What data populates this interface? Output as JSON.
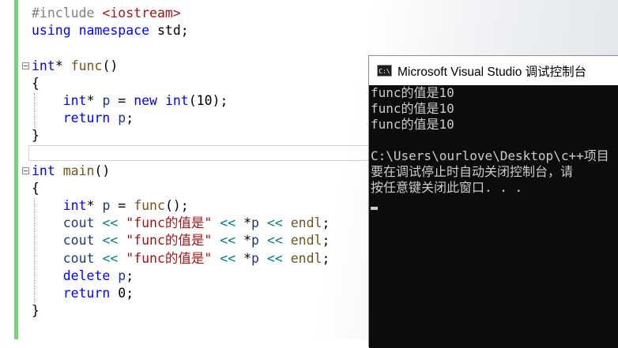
{
  "editor": {
    "lines": [
      {
        "tokens": [
          {
            "c": "pp",
            "t": "#include "
          },
          {
            "c": "inc",
            "t": "<iostream>"
          }
        ]
      },
      {
        "tokens": [
          {
            "c": "kw",
            "t": "using"
          },
          {
            "c": "tx",
            "t": " "
          },
          {
            "c": "kw",
            "t": "namespace"
          },
          {
            "c": "tx",
            "t": " std;"
          }
        ]
      },
      {
        "tokens": []
      },
      {
        "fold": true,
        "tokens": [
          {
            "c": "ty",
            "t": "int"
          },
          {
            "c": "tx",
            "t": "* "
          },
          {
            "c": "fn",
            "t": "func"
          },
          {
            "c": "tx",
            "t": "()"
          }
        ]
      },
      {
        "tokens": [
          {
            "c": "tx",
            "t": "{"
          }
        ]
      },
      {
        "tokens": [
          {
            "c": "tx",
            "t": "    "
          },
          {
            "c": "ty",
            "t": "int"
          },
          {
            "c": "tx",
            "t": "* "
          },
          {
            "c": "id",
            "t": "p"
          },
          {
            "c": "tx",
            "t": " = "
          },
          {
            "c": "kw",
            "t": "new"
          },
          {
            "c": "tx",
            "t": " "
          },
          {
            "c": "ty",
            "t": "int"
          },
          {
            "c": "tx",
            "t": "(10);"
          }
        ]
      },
      {
        "tokens": [
          {
            "c": "tx",
            "t": "    "
          },
          {
            "c": "kw",
            "t": "return"
          },
          {
            "c": "tx",
            "t": " "
          },
          {
            "c": "id",
            "t": "p"
          },
          {
            "c": "tx",
            "t": ";"
          }
        ]
      },
      {
        "tokens": [
          {
            "c": "tx",
            "t": "}"
          }
        ]
      },
      {
        "tokens": []
      },
      {
        "fold": true,
        "tokens": [
          {
            "c": "ty",
            "t": "int"
          },
          {
            "c": "tx",
            "t": " "
          },
          {
            "c": "fn",
            "t": "main"
          },
          {
            "c": "tx",
            "t": "()"
          }
        ]
      },
      {
        "tokens": [
          {
            "c": "tx",
            "t": "{"
          }
        ]
      },
      {
        "tokens": [
          {
            "c": "tx",
            "t": "    "
          },
          {
            "c": "ty",
            "t": "int"
          },
          {
            "c": "tx",
            "t": "* "
          },
          {
            "c": "id",
            "t": "p"
          },
          {
            "c": "tx",
            "t": " = "
          },
          {
            "c": "fn",
            "t": "func"
          },
          {
            "c": "tx",
            "t": "();"
          }
        ]
      },
      {
        "tokens": [
          {
            "c": "tx",
            "t": "    "
          },
          {
            "c": "id",
            "t": "cout"
          },
          {
            "c": "tx",
            "t": " "
          },
          {
            "c": "op",
            "t": "<<"
          },
          {
            "c": "tx",
            "t": " "
          },
          {
            "c": "st",
            "t": "\"func的值是\""
          },
          {
            "c": "tx",
            "t": " "
          },
          {
            "c": "op",
            "t": "<<"
          },
          {
            "c": "tx",
            "t": " *"
          },
          {
            "c": "id",
            "t": "p"
          },
          {
            "c": "tx",
            "t": " "
          },
          {
            "c": "op",
            "t": "<<"
          },
          {
            "c": "tx",
            "t": " "
          },
          {
            "c": "fn",
            "t": "endl"
          },
          {
            "c": "tx",
            "t": ";"
          }
        ]
      },
      {
        "tokens": [
          {
            "c": "tx",
            "t": "    "
          },
          {
            "c": "id",
            "t": "cout"
          },
          {
            "c": "tx",
            "t": " "
          },
          {
            "c": "op",
            "t": "<<"
          },
          {
            "c": "tx",
            "t": " "
          },
          {
            "c": "st",
            "t": "\"func的值是\""
          },
          {
            "c": "tx",
            "t": " "
          },
          {
            "c": "op",
            "t": "<<"
          },
          {
            "c": "tx",
            "t": " *"
          },
          {
            "c": "id",
            "t": "p"
          },
          {
            "c": "tx",
            "t": " "
          },
          {
            "c": "op",
            "t": "<<"
          },
          {
            "c": "tx",
            "t": " "
          },
          {
            "c": "fn",
            "t": "endl"
          },
          {
            "c": "tx",
            "t": ";"
          }
        ]
      },
      {
        "tokens": [
          {
            "c": "tx",
            "t": "    "
          },
          {
            "c": "id",
            "t": "cout"
          },
          {
            "c": "tx",
            "t": " "
          },
          {
            "c": "op",
            "t": "<<"
          },
          {
            "c": "tx",
            "t": " "
          },
          {
            "c": "st",
            "t": "\"func的值是\""
          },
          {
            "c": "tx",
            "t": " "
          },
          {
            "c": "op",
            "t": "<<"
          },
          {
            "c": "tx",
            "t": " *"
          },
          {
            "c": "id",
            "t": "p"
          },
          {
            "c": "tx",
            "t": " "
          },
          {
            "c": "op",
            "t": "<<"
          },
          {
            "c": "tx",
            "t": " "
          },
          {
            "c": "fn",
            "t": "endl"
          },
          {
            "c": "tx",
            "t": ";"
          }
        ]
      },
      {
        "tokens": [
          {
            "c": "tx",
            "t": "    "
          },
          {
            "c": "kw",
            "t": "delete"
          },
          {
            "c": "tx",
            "t": " "
          },
          {
            "c": "id",
            "t": "p"
          },
          {
            "c": "tx",
            "t": ";"
          }
        ]
      },
      {
        "tokens": [
          {
            "c": "tx",
            "t": "    "
          },
          {
            "c": "kw",
            "t": "return"
          },
          {
            "c": "tx",
            "t": " 0;"
          }
        ]
      },
      {
        "tokens": [
          {
            "c": "tx",
            "t": "}"
          }
        ]
      }
    ]
  },
  "console": {
    "title": "Microsoft Visual Studio 调试控制台",
    "icon": "console-app-icon",
    "icon_text": "C:\\",
    "output": [
      "func的值是10",
      "func的值是10",
      "func的值是10",
      "",
      "C:\\Users\\ourlove\\Desktop\\c++项目",
      "要在调试停止时自动关闭控制台，请",
      "按任意键关闭此窗口. . ."
    ]
  }
}
